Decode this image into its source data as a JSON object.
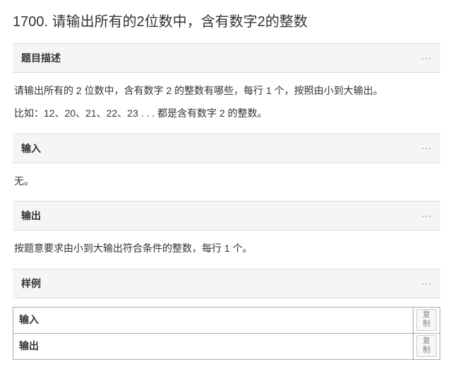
{
  "title": "1700. 请输出所有的2位数中，含有数字2的整数",
  "sections": {
    "desc": {
      "header": "题目描述",
      "p1": "请输出所有的 2 位数中，含有数字 2 的整数有哪些，每行 1 个，按照由小到大输出。",
      "p2": "比如：12、20、21、22、23 . . . 都是含有数字 2 的整数。"
    },
    "input": {
      "header": "输入",
      "body": "无。"
    },
    "output": {
      "header": "输出",
      "body": "按题意要求由小到大输出符合条件的整数，每行 1 个。"
    },
    "sample": {
      "header": "样例",
      "in_label": "输入",
      "out_label": "输出",
      "copy_label": "复制"
    }
  },
  "icons": {
    "more": "⋮"
  }
}
